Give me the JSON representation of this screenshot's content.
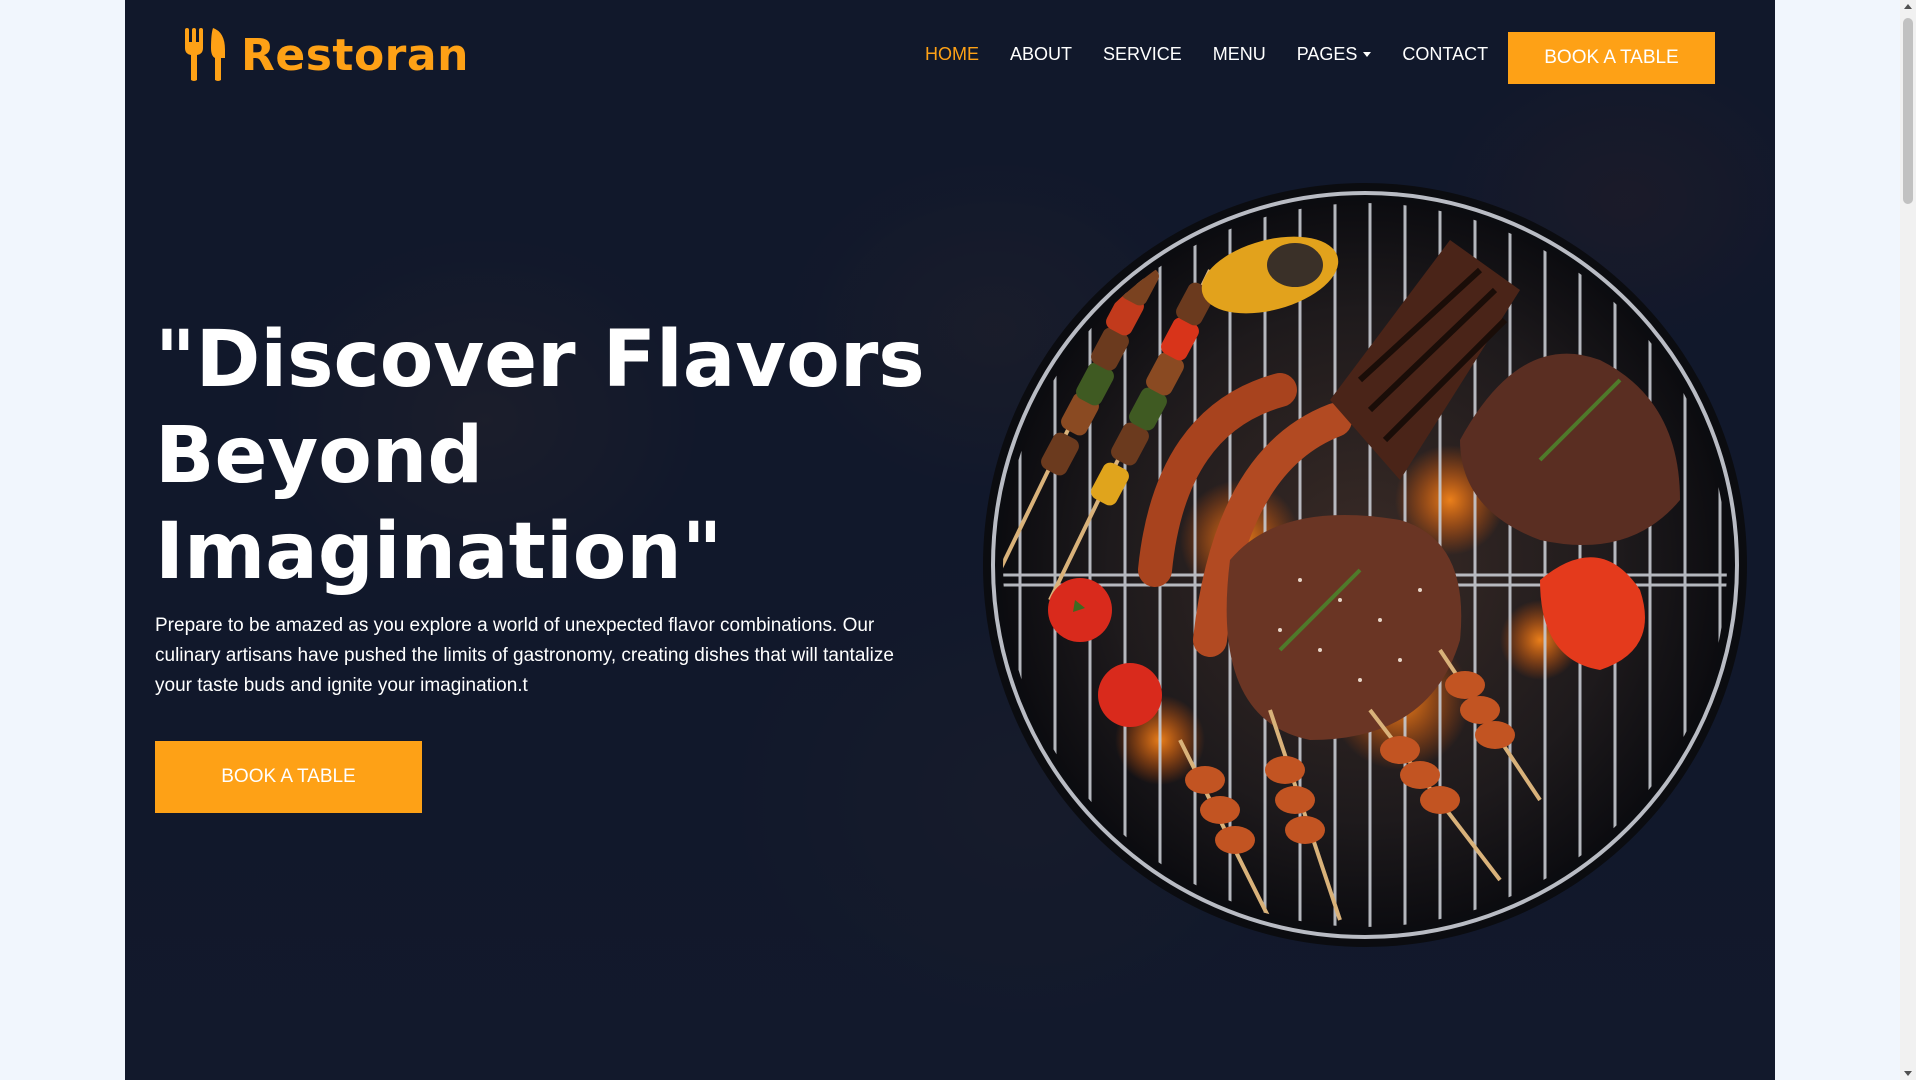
{
  "brand": {
    "name": "Restoran",
    "icon": "utensils-icon",
    "color": "#fea116"
  },
  "nav": {
    "items": [
      {
        "label": "Home",
        "active": true
      },
      {
        "label": "About",
        "active": false
      },
      {
        "label": "Service",
        "active": false
      },
      {
        "label": "Menu",
        "active": false
      },
      {
        "label": "Pages",
        "active": false,
        "dropdown": true
      },
      {
        "label": "Contact",
        "active": false
      }
    ],
    "book_label": "Book A Table"
  },
  "hero": {
    "title": "\"Discover Flavors Beyond Imagination\"",
    "description": "Prepare to be amazed as you explore a world of unexpected flavor combinations. Our culinary artisans have pushed the limits of gastronomy, creating dishes that will tantalize your taste buds and ignite your imagination.t",
    "book_label": "Book A Table",
    "image": "grill-with-meats-illustration"
  },
  "colors": {
    "accent": "#fea116",
    "background": "#0f172b"
  }
}
